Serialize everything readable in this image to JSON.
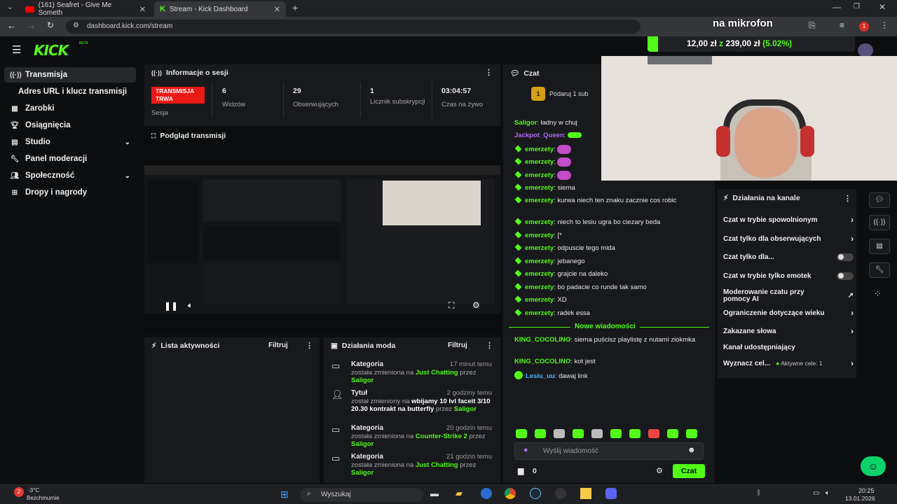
{
  "browser": {
    "tabs": [
      {
        "title": "(161) Seafret - Give Me Someth"
      },
      {
        "title": "Stream - Kick Dashboard"
      }
    ],
    "url": "dashboard.kick.com/stream",
    "notif_count": "1"
  },
  "overlay": {
    "mic_text": "na mikrofon",
    "goal_current": "12,00 zł",
    "goal_connector": "z",
    "goal_total": "239,00 zł",
    "goal_percent": "(5.02%)",
    "goal_fraction": 0.0502
  },
  "kick": {
    "logo": "KICK",
    "beta": "BETA"
  },
  "sidebar": {
    "items": [
      {
        "label": "Transmisja",
        "icon": "broadcast-icon"
      },
      {
        "label": "Adres URL i klucz transmisji"
      },
      {
        "label": "Zarobki",
        "icon": "earnings-icon"
      },
      {
        "label": "Osiągnięcia",
        "icon": "trophy-icon"
      },
      {
        "label": "Studio",
        "icon": "studio-icon"
      },
      {
        "label": "Panel moderacji",
        "icon": "wrench-icon"
      },
      {
        "label": "Społeczność",
        "icon": "community-icon"
      },
      {
        "label": "Dropy i nagrody",
        "icon": "gift-icon"
      }
    ]
  },
  "session": {
    "title": "Informacje o sesji",
    "live_badge": "TRANSMISJA TRWA",
    "live_label": "Sesja",
    "stats": [
      {
        "value": "6",
        "label": "Widzów"
      },
      {
        "value": "29",
        "label": "Obserwujących"
      },
      {
        "value": "1",
        "label": "Licznik subskrypcji"
      },
      {
        "value": "03:04:57",
        "label": "Czas na żywo"
      }
    ]
  },
  "preview": {
    "title": "Podgląd transmisji"
  },
  "activity": {
    "title": "Lista aktywności",
    "filter": "Filtruj"
  },
  "modlog": {
    "title": "Działania moda",
    "filter": "Filtruj",
    "entries": [
      {
        "type": "Kategoria",
        "time": "17 minut temu",
        "pre": "została zmieniona na",
        "value": "Just Chatting",
        "by": "przez",
        "user": "Saligor"
      },
      {
        "type": "Tytuł",
        "time": "2 godziny temu",
        "pre": "został zmieniony na",
        "value": "wbijamy 10 lvl faceit 3/10 20.30 kontrakt na butterfly",
        "by": "przez",
        "user": "Saligor"
      },
      {
        "type": "Kategoria",
        "time": "20 godzin temu",
        "pre": "została zmieniona na",
        "value": "Counter-Strike 2",
        "by": "przez",
        "user": "Saligor"
      },
      {
        "type": "Kategoria",
        "time": "21 godzin temu",
        "pre": "została zmieniona na",
        "value": "Just Chatting",
        "by": "przez",
        "user": "Saligor"
      }
    ]
  },
  "chat": {
    "title": "Czat",
    "pinned": "Podaruj 1 sub",
    "pinned_count": "1",
    "messages": [
      {
        "user": "Saligor",
        "text": "ładny w chuj",
        "color": "#53fc18"
      },
      {
        "user": "Jackpot_Queen",
        "text": "",
        "color": "#b26bf5"
      },
      {
        "user": "emerzety",
        "text": "",
        "color": "#53fc18"
      },
      {
        "user": "emerzety",
        "text": "",
        "color": "#53fc18"
      },
      {
        "user": "emerzety",
        "text": "",
        "color": "#53fc18"
      },
      {
        "user": "emerzety",
        "text": "siema",
        "color": "#53fc18"
      },
      {
        "user": "emerzety",
        "text": "kurwa niech ten znaku zacznie cos robic",
        "color": "#53fc18"
      },
      {
        "user": "emerzety",
        "text": "niech to lesiu ugra bo ciezary beda",
        "color": "#53fc18"
      },
      {
        "user": "emerzety",
        "text": "[*",
        "color": "#53fc18"
      },
      {
        "user": "emerzety",
        "text": "odpuscie tego mida",
        "color": "#53fc18"
      },
      {
        "user": "emerzety",
        "text": "jebanego",
        "color": "#53fc18"
      },
      {
        "user": "emerzety",
        "text": "grajcie na daleko",
        "color": "#53fc18"
      },
      {
        "user": "emerzety",
        "text": "bo padacie co runde tak samo",
        "color": "#53fc18"
      },
      {
        "user": "emerzety",
        "text": "XD",
        "color": "#53fc18"
      },
      {
        "user": "emerzety",
        "text": "radek essa",
        "color": "#53fc18"
      }
    ],
    "new_divider": "Nowe wiadomości",
    "new_messages": [
      {
        "user": "KING_COCOLINO",
        "text": "siema puścisz playlistę z nutami ziokmka",
        "color": "#53fc18"
      },
      {
        "user": "KING_COCOLINO",
        "text": "kot jest",
        "color": "#53fc18"
      },
      {
        "user": "Lesiu_uu",
        "text": "dawaj link",
        "color": "#4fb3ff"
      }
    ],
    "input_placeholder": "Wyślij wiadomość",
    "points": "0",
    "send": "Czat"
  },
  "channel_actions": {
    "title": "Działania na kanale",
    "items": [
      {
        "label": "Czat w trybie spowolnionym",
        "kind": "chevron"
      },
      {
        "label": "Czat tylko dla obserwujących",
        "kind": "chevron"
      },
      {
        "label": "Czat tylko dla...",
        "kind": "toggle"
      },
      {
        "label": "Czat w trybie tylko emotek",
        "kind": "toggle"
      },
      {
        "label": "Moderowanie czatu przy pomocy AI",
        "kind": "link"
      },
      {
        "label": "Ograniczenie dotyczące wieku",
        "kind": "chevron"
      },
      {
        "label": "Zakazane słowa",
        "kind": "chevron"
      },
      {
        "label": "Kanał udostępniający",
        "kind": "none"
      },
      {
        "label": "Wyznacz cel...",
        "kind": "chevron",
        "extra": "Aktywne cele: 1"
      }
    ]
  },
  "taskbar": {
    "weather_temp": "-3°C",
    "weather_desc": "Bezchmurnie",
    "weather_badge": "2",
    "search": "Wyszukaj",
    "time": "20:25",
    "date": "13.01.2026"
  }
}
